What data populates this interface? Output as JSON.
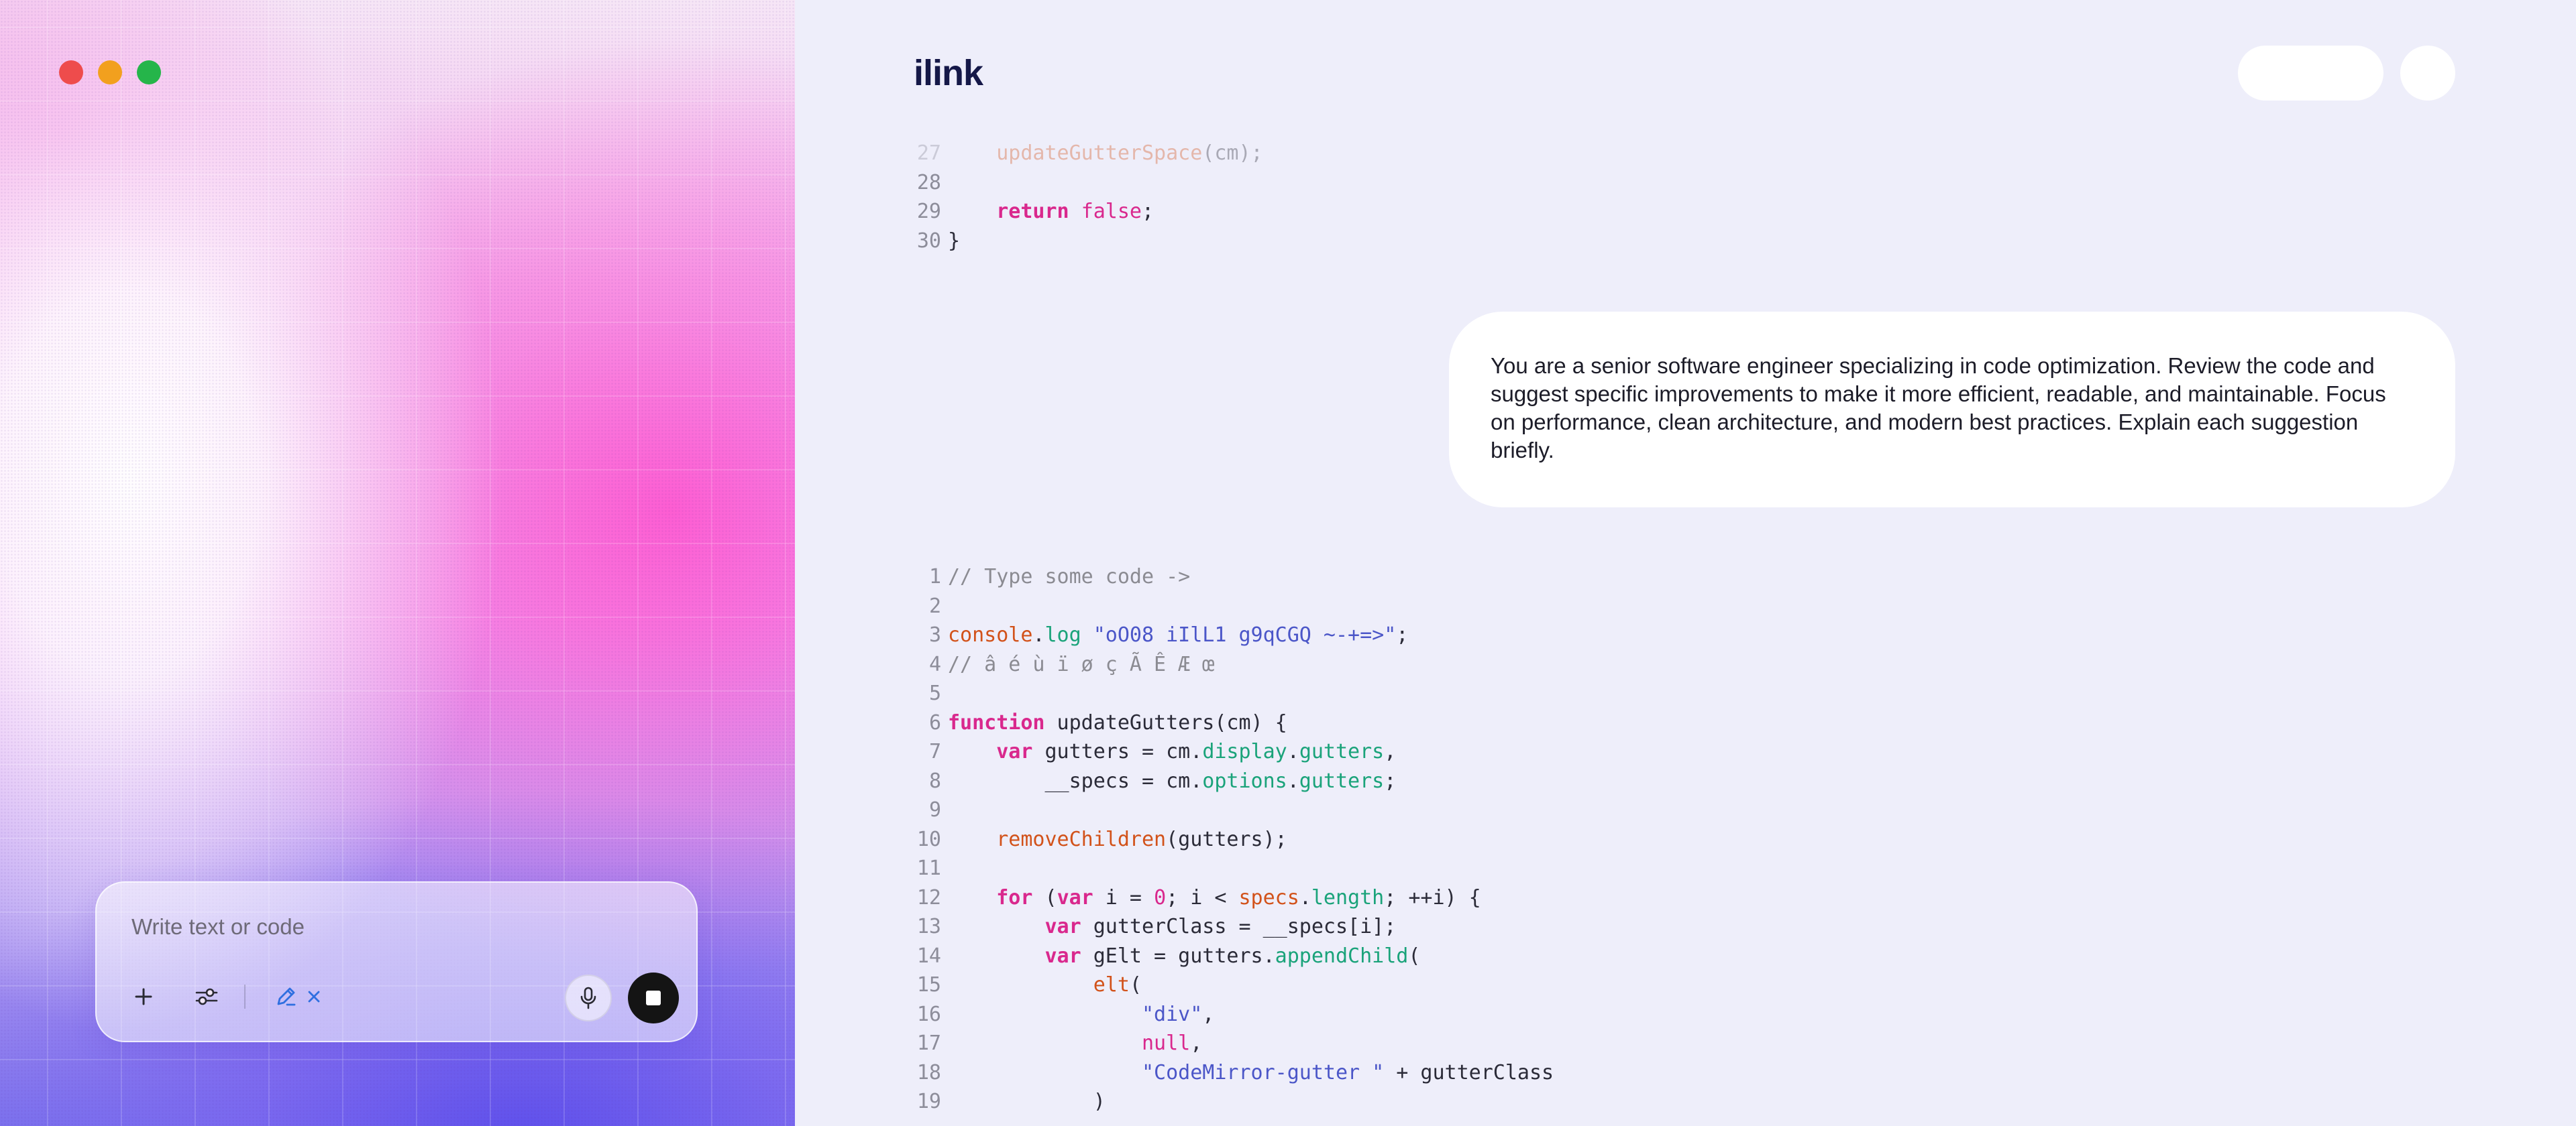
{
  "brand": {
    "name": "ilink"
  },
  "window_controls": {
    "close_color": "#ee4c4c",
    "minimize_color": "#f2a01e",
    "maximize_color": "#25b54a"
  },
  "composer": {
    "placeholder": "Write text or code",
    "value": "",
    "tools": {
      "add_icon": "plus-icon",
      "settings_icon": "sliders-icon",
      "edit_icon": "pen-icon",
      "clear_icon": "x-icon",
      "mic_icon": "microphone-icon",
      "stop_icon": "stop-icon"
    },
    "accent_color": "#2f6fe0"
  },
  "chat": {
    "user_message": "You are a senior software engineer specializing in code optimization. Review the code and suggest specific improvements to make it more efficient, readable, and maintainable. Focus on performance, clean architecture, and modern best practices. Explain each suggestion briefly."
  },
  "code_top": {
    "lines": [
      {
        "n": "27",
        "faded": true,
        "tokens": [
          {
            "t": "    ",
            "c": "plain"
          },
          {
            "t": "updateGutterSpace",
            "c": "fn"
          },
          {
            "t": "(cm);",
            "c": "plain"
          }
        ]
      },
      {
        "n": "28",
        "tokens": []
      },
      {
        "n": "29",
        "tokens": [
          {
            "t": "    ",
            "c": "plain"
          },
          {
            "t": "return",
            "c": "kw"
          },
          {
            "t": " ",
            "c": "plain"
          },
          {
            "t": "false",
            "c": "lit"
          },
          {
            "t": ";",
            "c": "plain"
          }
        ]
      },
      {
        "n": "30",
        "tokens": [
          {
            "t": "}",
            "c": "plain"
          }
        ]
      }
    ]
  },
  "code_main": {
    "lines": [
      {
        "n": "1",
        "tokens": [
          {
            "t": "// Type some code ->",
            "c": "comment"
          }
        ]
      },
      {
        "n": "2",
        "tokens": []
      },
      {
        "n": "3",
        "tokens": [
          {
            "t": "console",
            "c": "fn"
          },
          {
            "t": ".",
            "c": "plain"
          },
          {
            "t": "log",
            "c": "prop"
          },
          {
            "t": " ",
            "c": "plain"
          },
          {
            "t": "\"oO08 iIlL1 g9qCGQ ~-+=>\"",
            "c": "str"
          },
          {
            "t": ";",
            "c": "plain"
          }
        ]
      },
      {
        "n": "4",
        "tokens": [
          {
            "t": "// â é ù ï ø ç Ã Ê Æ œ",
            "c": "comment"
          }
        ]
      },
      {
        "n": "5",
        "tokens": []
      },
      {
        "n": "6",
        "tokens": [
          {
            "t": "function",
            "c": "kw"
          },
          {
            "t": " updateGutters(cm) {",
            "c": "plain"
          }
        ]
      },
      {
        "n": "7",
        "tokens": [
          {
            "t": "    ",
            "c": "plain"
          },
          {
            "t": "var",
            "c": "kw"
          },
          {
            "t": " gutters = cm.",
            "c": "plain"
          },
          {
            "t": "display",
            "c": "prop"
          },
          {
            "t": ".",
            "c": "plain"
          },
          {
            "t": "gutters",
            "c": "prop"
          },
          {
            "t": ",",
            "c": "plain"
          }
        ]
      },
      {
        "n": "8",
        "tokens": [
          {
            "t": "        __specs = cm.",
            "c": "plain"
          },
          {
            "t": "options",
            "c": "prop"
          },
          {
            "t": ".",
            "c": "plain"
          },
          {
            "t": "gutters",
            "c": "prop"
          },
          {
            "t": ";",
            "c": "plain"
          }
        ]
      },
      {
        "n": "9",
        "tokens": []
      },
      {
        "n": "10",
        "tokens": [
          {
            "t": "    ",
            "c": "plain"
          },
          {
            "t": "removeChildren",
            "c": "fn"
          },
          {
            "t": "(gutters);",
            "c": "plain"
          }
        ]
      },
      {
        "n": "11",
        "tokens": []
      },
      {
        "n": "12",
        "tokens": [
          {
            "t": "    ",
            "c": "plain"
          },
          {
            "t": "for",
            "c": "kw"
          },
          {
            "t": " (",
            "c": "plain"
          },
          {
            "t": "var",
            "c": "kw"
          },
          {
            "t": " i = ",
            "c": "plain"
          },
          {
            "t": "0",
            "c": "lit"
          },
          {
            "t": "; i < ",
            "c": "plain"
          },
          {
            "t": "specs",
            "c": "fn"
          },
          {
            "t": ".",
            "c": "plain"
          },
          {
            "t": "length",
            "c": "prop"
          },
          {
            "t": "; ++i) {",
            "c": "plain"
          }
        ]
      },
      {
        "n": "13",
        "tokens": [
          {
            "t": "        ",
            "c": "plain"
          },
          {
            "t": "var",
            "c": "kw"
          },
          {
            "t": " gutterClass = __specs[i];",
            "c": "plain"
          }
        ]
      },
      {
        "n": "14",
        "tokens": [
          {
            "t": "        ",
            "c": "plain"
          },
          {
            "t": "var",
            "c": "kw"
          },
          {
            "t": " gElt = gutters.",
            "c": "plain"
          },
          {
            "t": "appendChild",
            "c": "prop"
          },
          {
            "t": "(",
            "c": "plain"
          }
        ]
      },
      {
        "n": "15",
        "tokens": [
          {
            "t": "            ",
            "c": "plain"
          },
          {
            "t": "elt",
            "c": "fn"
          },
          {
            "t": "(",
            "c": "plain"
          }
        ]
      },
      {
        "n": "16",
        "tokens": [
          {
            "t": "                ",
            "c": "plain"
          },
          {
            "t": "\"div\"",
            "c": "str"
          },
          {
            "t": ",",
            "c": "plain"
          }
        ]
      },
      {
        "n": "17",
        "tokens": [
          {
            "t": "                ",
            "c": "plain"
          },
          {
            "t": "null",
            "c": "lit"
          },
          {
            "t": ",",
            "c": "plain"
          }
        ]
      },
      {
        "n": "18",
        "tokens": [
          {
            "t": "                ",
            "c": "plain"
          },
          {
            "t": "\"CodeMirror-gutter \"",
            "c": "str"
          },
          {
            "t": " + gutterClass",
            "c": "plain"
          }
        ]
      },
      {
        "n": "19",
        "tokens": [
          {
            "t": "            )",
            "c": "plain"
          }
        ]
      }
    ]
  }
}
